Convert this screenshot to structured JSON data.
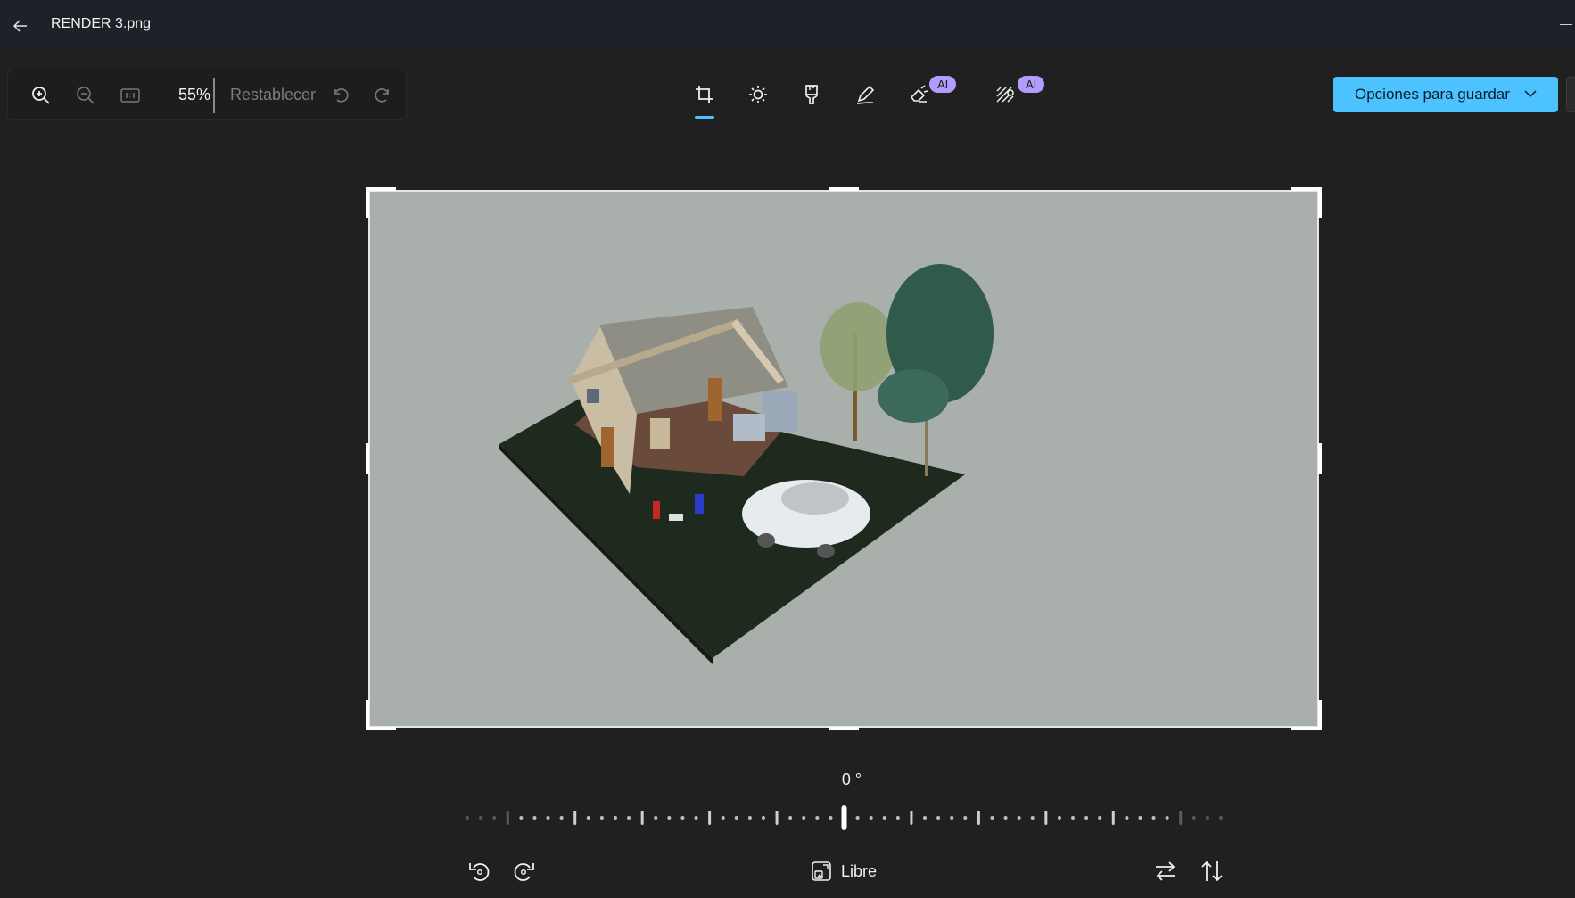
{
  "window": {
    "title": "RENDER 3.png"
  },
  "toolbar": {
    "zoom_value": "55%",
    "reset_label": "Restablecer",
    "tools": [
      {
        "name": "crop",
        "icon": "crop-icon",
        "active": true
      },
      {
        "name": "adjust",
        "icon": "brightness-icon"
      },
      {
        "name": "filter",
        "icon": "filter-icon"
      },
      {
        "name": "markup",
        "icon": "pen-icon"
      },
      {
        "name": "erase",
        "icon": "eraser-icon",
        "badge": "AI"
      },
      {
        "name": "background",
        "icon": "background-blur-icon",
        "badge": "AI"
      }
    ],
    "badge_erase": "AI",
    "badge_background": "AI",
    "save_label": "Opciones para guardar"
  },
  "editor": {
    "image_description_icon": "house-render-image",
    "rotation_angle": "0 °",
    "rotation_value_degrees": 0,
    "aspect_label": "Libre"
  },
  "colors": {
    "background": "#202020",
    "titlebar": "#1e2228",
    "accent": "#4cc2ff",
    "ai_badge": "#b49cff",
    "image_bg": "#a9afaa"
  }
}
